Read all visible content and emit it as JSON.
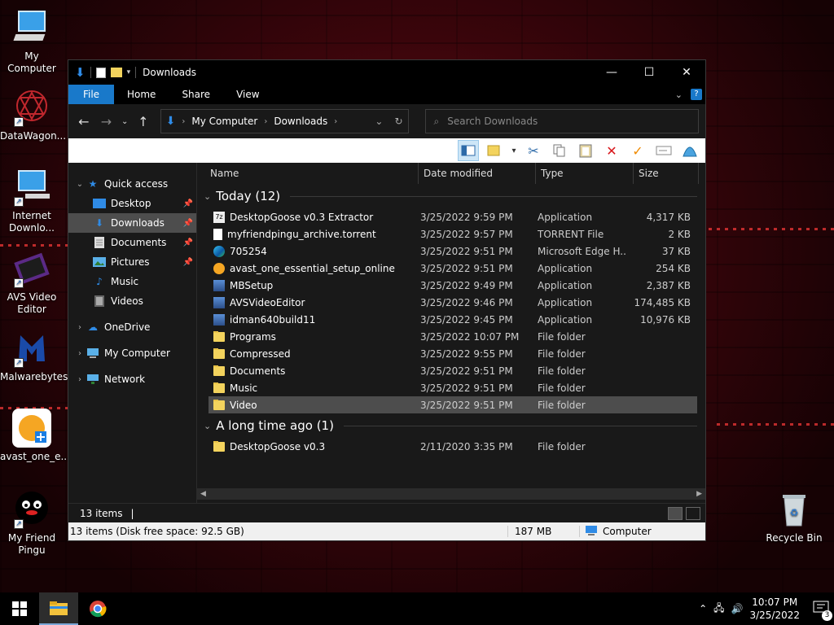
{
  "desktop": {
    "icons": [
      {
        "label": "My Computer",
        "icon": "monitor-icon"
      },
      {
        "label": "DataWagon...",
        "icon": "datawagon-icon"
      },
      {
        "label": "Internet Downlo...",
        "icon": "monitor-shortcut-icon"
      },
      {
        "label": "AVS Video Editor",
        "icon": "film-icon"
      },
      {
        "label": "Malwarebytes",
        "icon": "malwarebytes-icon"
      },
      {
        "label": "avast_one_e...",
        "icon": "avast-icon"
      },
      {
        "label": "My Friend Pingu",
        "icon": "pingu-icon"
      },
      {
        "label": "Recycle Bin",
        "icon": "recycle-bin-icon"
      }
    ]
  },
  "window": {
    "title": "Downloads",
    "controls": {
      "minimize": "—",
      "maximize": "☐",
      "close": "✕"
    }
  },
  "ribbon": {
    "tabs": [
      "File",
      "Home",
      "Share",
      "View"
    ]
  },
  "nav": {
    "breadcrumb": [
      "My Computer",
      "Downloads"
    ],
    "search_placeholder": "Search Downloads"
  },
  "sidebar": {
    "quick_access": "Quick access",
    "pinned": [
      {
        "label": "Desktop",
        "pinned": true
      },
      {
        "label": "Downloads",
        "pinned": true,
        "selected": true
      },
      {
        "label": "Documents",
        "pinned": true
      },
      {
        "label": "Pictures",
        "pinned": true
      },
      {
        "label": "Music",
        "pinned": false
      },
      {
        "label": "Videos",
        "pinned": false
      }
    ],
    "roots": [
      "OneDrive",
      "My Computer",
      "Network"
    ]
  },
  "columns": [
    "Name",
    "Date modified",
    "Type",
    "Size"
  ],
  "groups": [
    {
      "title": "Today (12)",
      "rows": [
        {
          "name": "DesktopGoose v0.3 Extractor",
          "date": "3/25/2022 9:59 PM",
          "type": "Application",
          "size": "4,317 KB",
          "icon": "archive-icon"
        },
        {
          "name": "myfriendpingu_archive.torrent",
          "date": "3/25/2022 9:57 PM",
          "type": "TORRENT File",
          "size": "2 KB",
          "icon": "file-icon"
        },
        {
          "name": "705254",
          "date": "3/25/2022 9:51 PM",
          "type": "Microsoft Edge H...",
          "size": "37 KB",
          "icon": "edge-icon"
        },
        {
          "name": "avast_one_essential_setup_online",
          "date": "3/25/2022 9:51 PM",
          "type": "Application",
          "size": "254 KB",
          "icon": "avast-icon"
        },
        {
          "name": "MBSetup",
          "date": "3/25/2022 9:49 PM",
          "type": "Application",
          "size": "2,387 KB",
          "icon": "installer-icon"
        },
        {
          "name": "AVSVideoEditor",
          "date": "3/25/2022 9:46 PM",
          "type": "Application",
          "size": "174,485 KB",
          "icon": "installer-icon"
        },
        {
          "name": "idman640build11",
          "date": "3/25/2022 9:45 PM",
          "type": "Application",
          "size": "10,976 KB",
          "icon": "installer-icon"
        },
        {
          "name": "Programs",
          "date": "3/25/2022 10:07 PM",
          "type": "File folder",
          "size": "",
          "icon": "folder-icon"
        },
        {
          "name": "Compressed",
          "date": "3/25/2022 9:55 PM",
          "type": "File folder",
          "size": "",
          "icon": "folder-icon"
        },
        {
          "name": "Documents",
          "date": "3/25/2022 9:51 PM",
          "type": "File folder",
          "size": "",
          "icon": "folder-icon"
        },
        {
          "name": "Music",
          "date": "3/25/2022 9:51 PM",
          "type": "File folder",
          "size": "",
          "icon": "folder-icon"
        },
        {
          "name": "Video",
          "date": "3/25/2022 9:51 PM",
          "type": "File folder",
          "size": "",
          "icon": "folder-icon",
          "selected": true
        }
      ]
    },
    {
      "title": "A long time ago (1)",
      "rows": [
        {
          "name": "DesktopGoose v0.3",
          "date": "2/11/2020 3:35 PM",
          "type": "File folder",
          "size": "",
          "icon": "folder-icon"
        }
      ]
    }
  ],
  "status": {
    "count": "13 items",
    "cursor": "|",
    "classic_left": "13 items (Disk free space: 92.5 GB)",
    "classic_mid": "187 MB",
    "classic_right": "Computer"
  },
  "taskbar": {
    "time": "10:07 PM",
    "date": "3/25/2022",
    "notifications": "3"
  },
  "colors": {
    "accent": "#1979ca",
    "folder": "#f3d35d",
    "selection": "#4d4d4d"
  }
}
